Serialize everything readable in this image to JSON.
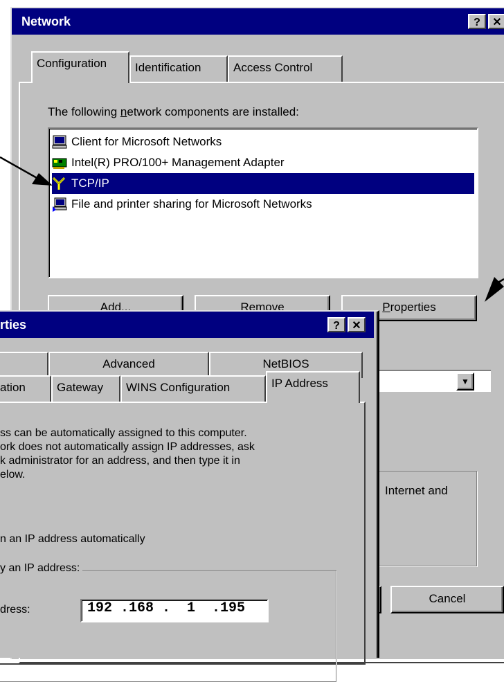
{
  "network": {
    "title": "Network",
    "help_btn": "?",
    "close_btn": "✕",
    "tabs": [
      "Configuration",
      "Identification",
      "Access Control"
    ],
    "components_label": {
      "pre": "The following ",
      "accel": "n",
      "post": "etwork components are installed:"
    },
    "components": [
      {
        "label": "Client for Microsoft Networks",
        "icon": "computer-icon",
        "selected": false
      },
      {
        "label": "Intel(R) PRO/100+ Management Adapter",
        "icon": "network-card-icon",
        "selected": false
      },
      {
        "label": "TCP/IP",
        "icon": "protocol-icon",
        "selected": true
      },
      {
        "label": "File and printer sharing for Microsoft Networks",
        "icon": "sharing-icon",
        "selected": false
      }
    ],
    "buttons": {
      "add": "Add...",
      "remove": "Remove",
      "properties": "Properties",
      "properties_accel": "P"
    },
    "description_fragment": "Internet and",
    "cancel": "Cancel"
  },
  "tcpip": {
    "title_fragment": "rties",
    "help_btn": "?",
    "close_btn": "✕",
    "tabs_back": [
      "Advanced",
      "NetBIOS"
    ],
    "tabs_front": [
      "ation",
      "Gateway",
      "WINS Configuration",
      "IP Address"
    ],
    "info_lines": [
      "ss can be automatically assigned to this computer.",
      "ork does not automatically assign IP addresses, ask",
      "k administrator for an address, and then type it in",
      "elow."
    ],
    "option_auto": "n an IP address automatically",
    "option_specify": "y an IP address:",
    "ip_label": "dress:",
    "ip_value": "192 .168 .  1  .195"
  },
  "colors": {
    "titlebar": "#000080",
    "face": "#c0c0c0",
    "selection": "#000080"
  }
}
